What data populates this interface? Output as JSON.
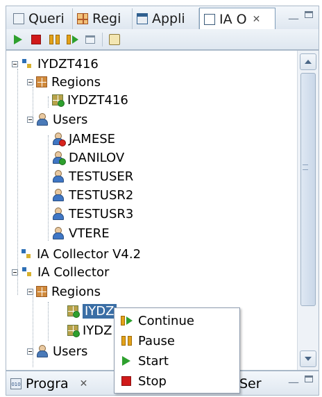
{
  "top_tabs": [
    {
      "label": "Queri",
      "icon": "document-icon",
      "active": false
    },
    {
      "label": "Regi",
      "icon": "grid-icon",
      "active": false
    },
    {
      "label": "Appli",
      "icon": "application-icon",
      "active": false
    },
    {
      "label": "IA O",
      "icon": "window-icon",
      "active": true,
      "close": "✕"
    }
  ],
  "toolbar": [
    "start-icon",
    "stop-icon",
    "pause-icon",
    "continue-icon",
    "window-icon",
    "refresh-icon"
  ],
  "tree": {
    "n1": "IYDZT416",
    "n2": "Regions",
    "n3": "IYDZT416",
    "n4": "Users",
    "users": [
      "JAMESE",
      "DANILOV",
      "TESTUSER",
      "TESTUSR2",
      "TESTUSR3",
      "VTERE"
    ],
    "n5": "IA Collector V4.2",
    "n6": "IA Collector",
    "n7": "Regions",
    "n8": "IYDZ",
    "n9": "IYDZ",
    "n10": "Users"
  },
  "context_menu": {
    "items": [
      {
        "label": "Continue",
        "icon": "continue-icon"
      },
      {
        "label": "Pause",
        "icon": "pause-icon"
      },
      {
        "label": "Start",
        "icon": "start-icon"
      },
      {
        "label": "Stop",
        "icon": "stop-icon"
      }
    ]
  },
  "bottom_tabs": [
    {
      "label": "Progra",
      "icon": "binary-icon",
      "close": "✕"
    },
    {
      "label": "Ser",
      "icon": "",
      "close": ""
    }
  ],
  "status_colors": {
    "running": "#2ea02e",
    "stopped": "#d8231d",
    "selection": "#3a6ea5"
  }
}
